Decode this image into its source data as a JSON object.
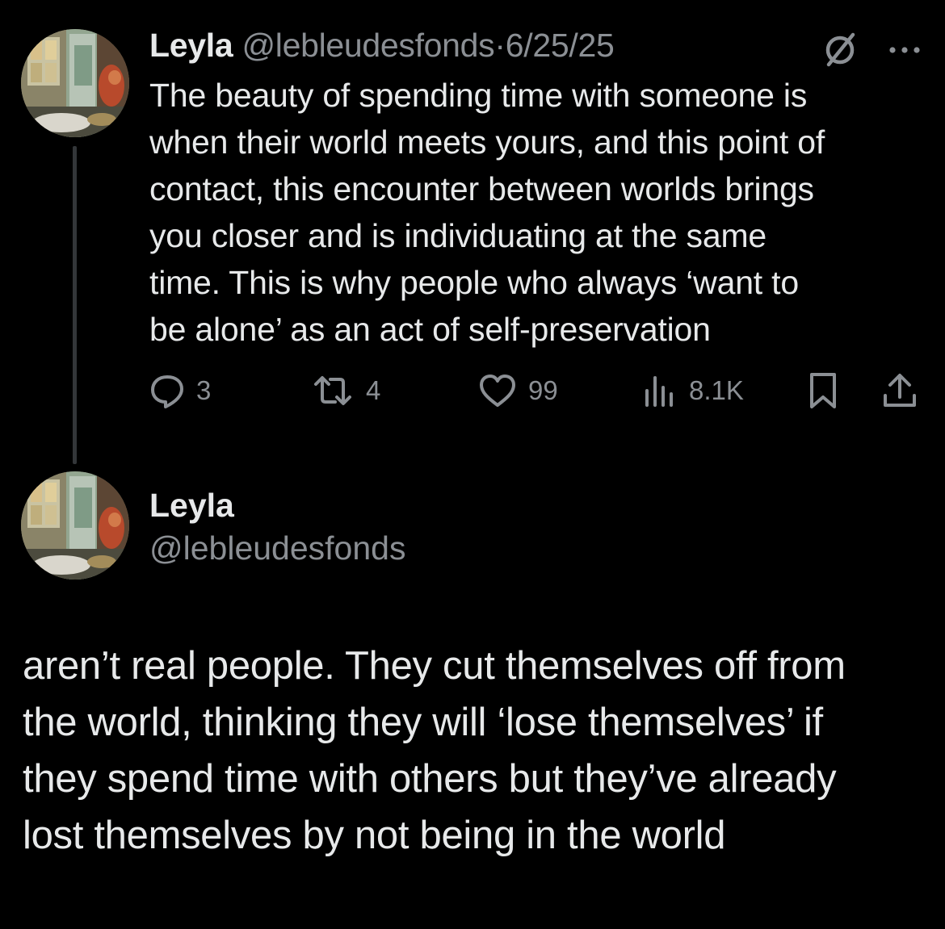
{
  "tweet1": {
    "author": {
      "display_name": "Leyla",
      "handle": "@lebleudesfonds",
      "avatar_icon": "painting-avatar"
    },
    "separator": "·",
    "date": "6/25/25",
    "menu_icon": "more-dots-icon",
    "status_icon": "slashed-circle-icon",
    "text": "The beauty of spending time with someone is\nwhen their world meets yours, and this point of\ncontact, this encounter between worlds brings\nyou closer and is individuating at the same\ntime. This is why people who always ‘want to\nbe alone’ as an act of self-preservation",
    "metrics": {
      "replies": "3",
      "reposts": "4",
      "likes": "99",
      "views": "8.1K"
    }
  },
  "tweet2": {
    "author": {
      "display_name": "Leyla",
      "handle": "@lebleudesfonds",
      "avatar_icon": "painting-avatar"
    },
    "text": "aren’t real people. They cut themselves off from\nthe world, thinking they will ‘lose themselves’ if\nthey spend time with others but they’ve already\nlost themselves by not being in the world"
  },
  "colors": {
    "background": "#000000",
    "primary_text": "#e7e9ea",
    "secondary_text": "#8b8f94",
    "thread_line": "#333639"
  }
}
